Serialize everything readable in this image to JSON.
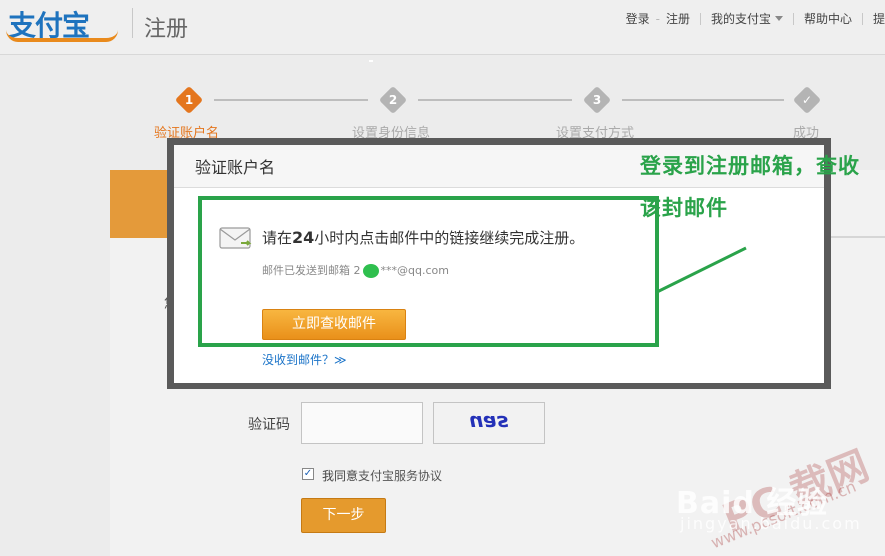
{
  "header": {
    "logo_text": "支付宝",
    "subtitle": "注册",
    "nav": {
      "login": "登录",
      "separator": "-",
      "register": "注册",
      "my_alipay": "我的支付宝",
      "help": "帮助中心",
      "more": "提"
    }
  },
  "steps": [
    {
      "num": "1",
      "label": "验证账户名",
      "active": true
    },
    {
      "num": "2",
      "label": "设置身份信息",
      "active": false
    },
    {
      "num": "3",
      "label": "设置支付方式",
      "active": false
    },
    {
      "num": "✓",
      "label": "成功",
      "active": false
    }
  ],
  "form": {
    "partial_label": "您",
    "captcha_label": "验证码",
    "captcha_input_value": "",
    "captcha_image_text": "uas",
    "agree_checked": "✓",
    "agree_prefix": "我同意",
    "agree_link": "支付宝服务协议",
    "next_button": "下一步"
  },
  "modal": {
    "title": "验证账户名",
    "msg_prefix": "请在",
    "msg_hours": "24",
    "msg_suffix": "小时内点击邮件中的链接继续完成注册。",
    "sent_prefix": "邮件已发送到邮箱 2",
    "sent_suffix": "***@qq.com",
    "check_button": "立即查收邮件",
    "no_mail": "没收到邮件？",
    "no_mail_caret": "≫"
  },
  "annotation": {
    "line1": "登录到注册邮箱，查收",
    "line2": "该封邮件",
    "color": "#2aa34a"
  },
  "watermarks": {
    "baidu": "Baid 经验",
    "baidu_url": "jingyan.baidu.com",
    "pc": "PC 载网",
    "pc_url": "www.pcsoft.com.cn"
  },
  "colors": {
    "brand_blue": "#1e73be",
    "brand_orange": "#e4761e",
    "annotation_green": "#2aa34a"
  }
}
